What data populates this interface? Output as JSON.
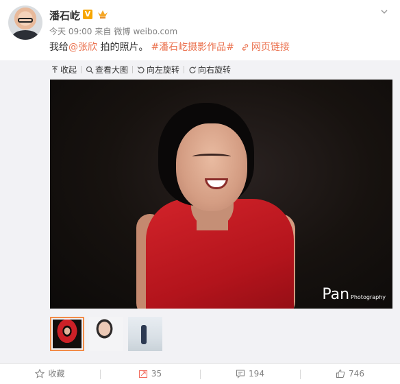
{
  "user": {
    "name": "潘石屹",
    "verified_badge": "V",
    "avatar": "avatar",
    "time": "今天 09:00",
    "source_prefix": "来自",
    "source_app": "微博",
    "source_url": "weibo.com"
  },
  "post": {
    "text_before": "我给",
    "mention": "@张欣",
    "text_after": " 拍的照片。",
    "hashtag": "#潘石屹摄影作品#",
    "web_link": "网页链接"
  },
  "toolbar": {
    "collapse": "收起",
    "view_large": "查看大图",
    "rotate_left": "向左旋转",
    "rotate_right": "向右旋转"
  },
  "photo": {
    "watermark_main": "Pan",
    "watermark_sub": "Photography"
  },
  "thumbnails": [
    {
      "selected": true
    },
    {
      "selected": false
    },
    {
      "selected": false
    }
  ],
  "actions": {
    "favorite": "收藏",
    "repost_count": "35",
    "comment_count": "194",
    "like_count": "746"
  },
  "colors": {
    "accent": "#eb7350",
    "badge": "#f7a600",
    "dress": "#d2232a",
    "panel": "#f2f2f5"
  }
}
